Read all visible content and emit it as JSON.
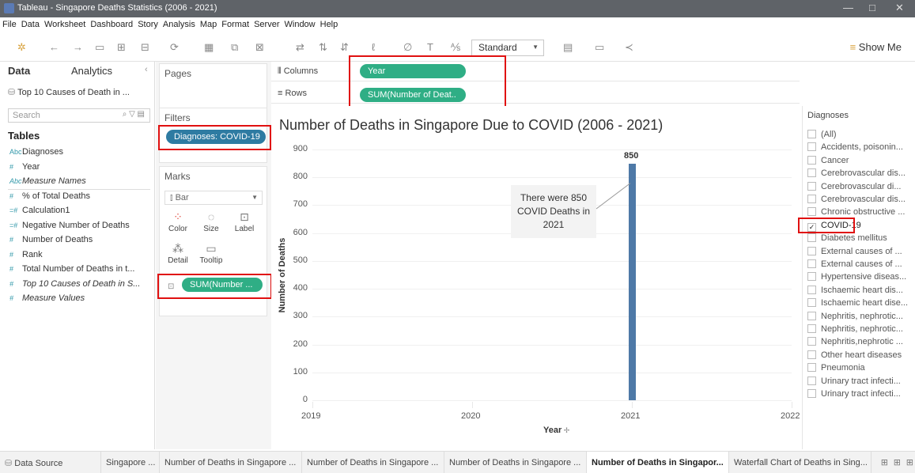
{
  "window": {
    "title": "Tableau - Singapore Deaths Statistics (2006 - 2021)",
    "controls": [
      "—",
      "□",
      "✕"
    ]
  },
  "menu": [
    "File",
    "Data",
    "Worksheet",
    "Dashboard",
    "Story",
    "Analysis",
    "Map",
    "Format",
    "Server",
    "Window",
    "Help"
  ],
  "toolbar": {
    "fit_value": "Standard",
    "show_me_label": "Show Me"
  },
  "data_pane": {
    "tab_data": "Data",
    "tab_analytics": "Analytics",
    "source": "Top 10 Causes of Death in ...",
    "search_placeholder": "Search",
    "tables_label": "Tables",
    "fields": [
      {
        "icon": "Abc",
        "name": "Diagnoses",
        "italic": false
      },
      {
        "icon": "#",
        "name": "Year",
        "italic": false
      },
      {
        "icon": "Abc",
        "name": "Measure Names",
        "italic": true
      },
      {
        "icon": "#",
        "name": "% of Total Deaths",
        "italic": false
      },
      {
        "icon": "=#",
        "name": "Calculation1",
        "italic": false
      },
      {
        "icon": "=#",
        "name": "Negative Number of Deaths",
        "italic": false
      },
      {
        "icon": "#",
        "name": "Number of Deaths",
        "italic": false
      },
      {
        "icon": "#",
        "name": "Rank",
        "italic": false
      },
      {
        "icon": "#",
        "name": "Total Number of Deaths in t...",
        "italic": false
      },
      {
        "icon": "#",
        "name": "Top 10 Causes of Death in S...",
        "italic": true
      },
      {
        "icon": "#",
        "name": "Measure Values",
        "italic": true
      }
    ]
  },
  "pages_card": {
    "title": "Pages"
  },
  "filters_card": {
    "title": "Filters",
    "pill": "Diagnoses: COVID-19"
  },
  "marks_card": {
    "title": "Marks",
    "mark_type": "Bar",
    "buttons": [
      "Color",
      "Size",
      "Label",
      "Detail",
      "Tooltip"
    ],
    "pill": "SUM(Number ..."
  },
  "shelves": {
    "columns_label": "Columns",
    "rows_label": "Rows",
    "columns_pill": "Year",
    "rows_pill": "SUM(Number of Deat.."
  },
  "chart_data": {
    "type": "bar",
    "title": "Number of Deaths in Singapore Due to COVID (2006 - 2021)",
    "xlabel": "Year",
    "ylabel": "Number of Deaths",
    "x_ticks": [
      "2019",
      "2020",
      "2021",
      "2022"
    ],
    "y_ticks": [
      0,
      100,
      200,
      300,
      400,
      500,
      600,
      700,
      800,
      900
    ],
    "ylim": [
      0,
      900
    ],
    "xlim": [
      2019,
      2022
    ],
    "series": [
      {
        "x": [
          2021
        ],
        "values": [
          850
        ]
      }
    ],
    "data_label": "850",
    "annotation": "There were 850 COVID Deaths in 2021",
    "grid": true
  },
  "legend": {
    "title": "Diagnoses",
    "items": [
      {
        "label": "(All)",
        "checked": false
      },
      {
        "label": "Accidents, poisonin...",
        "checked": false
      },
      {
        "label": "Cancer",
        "checked": false
      },
      {
        "label": "Cerebrovascular dis...",
        "checked": false
      },
      {
        "label": "Cerebrovascular  di...",
        "checked": false
      },
      {
        "label": "Cerebrovascular dis...",
        "checked": false
      },
      {
        "label": "Chronic obstructive ...",
        "checked": false
      },
      {
        "label": "COVID-19",
        "checked": true
      },
      {
        "label": "Diabetes mellitus",
        "checked": false
      },
      {
        "label": "External causes of ...",
        "checked": false
      },
      {
        "label": "External causes  of ...",
        "checked": false
      },
      {
        "label": "Hypertensive diseas...",
        "checked": false
      },
      {
        "label": "Ischaemic heart dis...",
        "checked": false
      },
      {
        "label": "Ischaemic heart dise...",
        "checked": false
      },
      {
        "label": "Nephritis, nephrotic...",
        "checked": false
      },
      {
        "label": "Nephritis, nephrotic...",
        "checked": false
      },
      {
        "label": "Nephritis,nephrotic ...",
        "checked": false
      },
      {
        "label": "Other heart diseases",
        "checked": false
      },
      {
        "label": "Pneumonia",
        "checked": false
      },
      {
        "label": "Urinary tract infecti...",
        "checked": false
      },
      {
        "label": "Urinary tract infecti...",
        "checked": false
      }
    ]
  },
  "bottom_tabs": [
    "Data Source",
    "Singapore ...",
    "Number of Deaths in Singapore ...",
    "Number of Deaths in Singapore ...",
    "Number of Deaths in Singapore ...",
    "Number of Deaths in Singapor...",
    "Waterfall Chart of Deaths in Sing..."
  ],
  "active_tab_index": 5,
  "colors": {
    "bar": "#4e79a7",
    "pill_green": "#2fae85",
    "pill_blue": "#2e7ba2",
    "highlight_box": "#e01010"
  }
}
